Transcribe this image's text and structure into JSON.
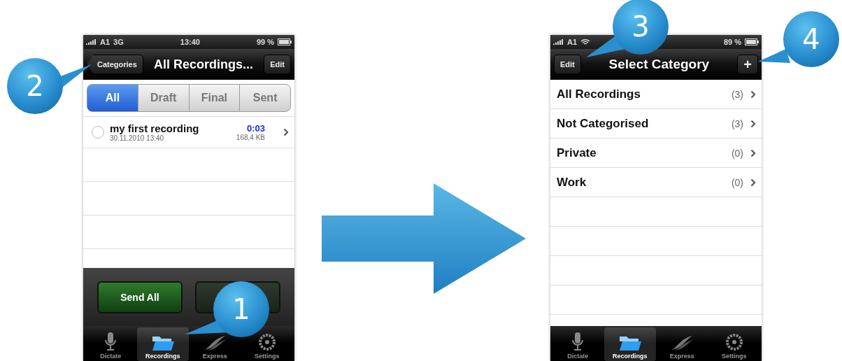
{
  "screens": [
    {
      "kind": "recordings",
      "status_bar": {
        "carrier": "A1",
        "network": "3G",
        "time": "13:40",
        "battery": "99 %",
        "wifi": false
      },
      "nav_bar": {
        "left_button": "Categories",
        "title": "All Recordings...",
        "right_button": "Edit"
      },
      "filter_tabs": [
        {
          "label": "All",
          "selected": true
        },
        {
          "label": "Draft",
          "selected": false
        },
        {
          "label": "Final",
          "selected": false
        },
        {
          "label": "Sent",
          "selected": false
        }
      ],
      "recordings": [
        {
          "title": "my first recording",
          "date": "30.11.2010 13:40",
          "duration": "0:03",
          "size": "168,4 KB",
          "selected": false
        }
      ],
      "toolbar": [
        {
          "label": "Send All",
          "kind": "green"
        },
        {
          "kind": "dark"
        }
      ],
      "tab_bar": [
        {
          "label": "Dictate",
          "selected": false
        },
        {
          "label": "Recordings",
          "selected": true
        },
        {
          "label": "Express",
          "selected": false
        },
        {
          "label": "Settings",
          "selected": false
        }
      ]
    },
    {
      "kind": "categories",
      "status_bar": {
        "carrier": "A1",
        "battery": "89 %",
        "wifi": true
      },
      "nav_bar": {
        "left_button": "Edit",
        "title": "Select Category",
        "right_button": "+"
      },
      "categories": [
        {
          "name": "All Recordings",
          "count": "(3)"
        },
        {
          "name": "Not Categorised",
          "count": "(3)"
        },
        {
          "name": "Private",
          "count": "(0)"
        },
        {
          "name": "Work",
          "count": "(0)"
        }
      ],
      "tab_bar": [
        {
          "label": "Dictate",
          "selected": false
        },
        {
          "label": "Recordings",
          "selected": true
        },
        {
          "label": "Express",
          "selected": false
        },
        {
          "label": "Settings",
          "selected": false
        }
      ]
    }
  ],
  "callouts": [
    {
      "number": "2"
    },
    {
      "number": "1"
    },
    {
      "number": "3"
    },
    {
      "number": "4"
    }
  ]
}
